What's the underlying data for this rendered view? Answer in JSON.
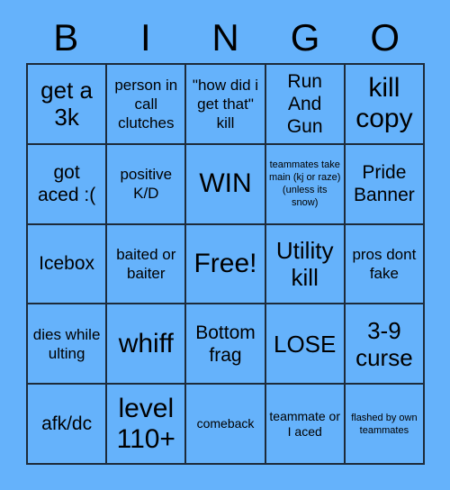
{
  "card": {
    "title": "BINGO",
    "background_color": "#65b2fb",
    "border_color": "#1d2b3a",
    "text_color": "#000000",
    "header": {
      "letters": [
        "B",
        "I",
        "N",
        "G",
        "O"
      ]
    },
    "grid": {
      "rows": 5,
      "columns": 5,
      "free_space": {
        "row": 3,
        "column": 3,
        "label": "Free!"
      },
      "cells": [
        {
          "row": 1,
          "column": 1,
          "column_letter": "B",
          "text": "get a 3k",
          "size": "lg"
        },
        {
          "row": 1,
          "column": 2,
          "column_letter": "I",
          "text": "person in call clutches",
          "size": "sm"
        },
        {
          "row": 1,
          "column": 3,
          "column_letter": "N",
          "text": "\"how did i get that\" kill",
          "size": "sm"
        },
        {
          "row": 1,
          "column": 4,
          "column_letter": "G",
          "text": "Run And Gun",
          "size": "md"
        },
        {
          "row": 1,
          "column": 5,
          "column_letter": "O",
          "text": "kill copy",
          "size": "xl"
        },
        {
          "row": 2,
          "column": 1,
          "column_letter": "B",
          "text": "got aced :(",
          "size": "md"
        },
        {
          "row": 2,
          "column": 2,
          "column_letter": "I",
          "text": "positive K/D",
          "size": "sm"
        },
        {
          "row": 2,
          "column": 3,
          "column_letter": "N",
          "text": "WIN",
          "size": "xl"
        },
        {
          "row": 2,
          "column": 4,
          "column_letter": "G",
          "text": "teammates take main (kj or raze) (unless its snow)",
          "size": "xxs"
        },
        {
          "row": 2,
          "column": 5,
          "column_letter": "O",
          "text": "Pride Banner",
          "size": "md"
        },
        {
          "row": 3,
          "column": 1,
          "column_letter": "B",
          "text": "Icebox",
          "size": "md"
        },
        {
          "row": 3,
          "column": 2,
          "column_letter": "I",
          "text": "baited or baiter",
          "size": "sm"
        },
        {
          "row": 3,
          "column": 3,
          "column_letter": "N",
          "text": "Free!",
          "size": "xl"
        },
        {
          "row": 3,
          "column": 4,
          "column_letter": "G",
          "text": "Utility kill",
          "size": "lg"
        },
        {
          "row": 3,
          "column": 5,
          "column_letter": "O",
          "text": "pros dont fake",
          "size": "sm"
        },
        {
          "row": 4,
          "column": 1,
          "column_letter": "B",
          "text": "dies while ulting",
          "size": "sm"
        },
        {
          "row": 4,
          "column": 2,
          "column_letter": "I",
          "text": "whiff",
          "size": "xl"
        },
        {
          "row": 4,
          "column": 3,
          "column_letter": "N",
          "text": "Bottom frag",
          "size": "md"
        },
        {
          "row": 4,
          "column": 4,
          "column_letter": "G",
          "text": "LOSE",
          "size": "lg"
        },
        {
          "row": 4,
          "column": 5,
          "column_letter": "O",
          "text": "3-9 curse",
          "size": "lg"
        },
        {
          "row": 5,
          "column": 1,
          "column_letter": "B",
          "text": "afk/dc",
          "size": "md"
        },
        {
          "row": 5,
          "column": 2,
          "column_letter": "I",
          "text": "level 110+",
          "size": "xl"
        },
        {
          "row": 5,
          "column": 3,
          "column_letter": "N",
          "text": "comeback",
          "size": "xs"
        },
        {
          "row": 5,
          "column": 4,
          "column_letter": "G",
          "text": "teammate or I aced",
          "size": "xs"
        },
        {
          "row": 5,
          "column": 5,
          "column_letter": "O",
          "text": "flashed by own teammates",
          "size": "xxs"
        }
      ]
    }
  }
}
